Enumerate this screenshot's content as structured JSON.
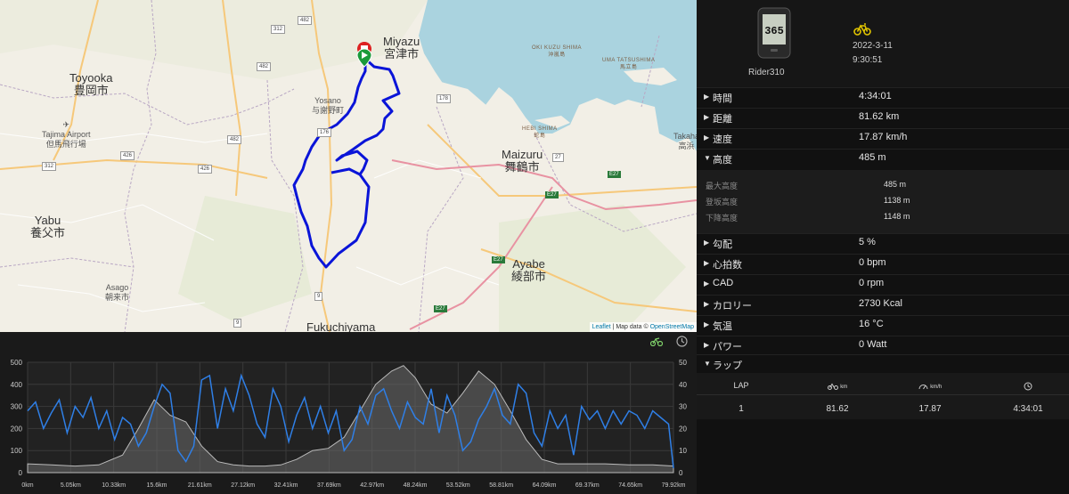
{
  "map": {
    "places": [
      {
        "name": "Toyooka",
        "jp": "豊岡市"
      },
      {
        "name": "Yabu",
        "jp": "養父市"
      },
      {
        "name": "Miyazu",
        "jp": "宮津市"
      },
      {
        "name": "Maizuru",
        "jp": "舞鶴市"
      },
      {
        "name": "Ayabe",
        "jp": "綾部市"
      },
      {
        "name": "Fukuchiyama",
        "jp": ""
      },
      {
        "name": "Yosano",
        "jp": "与謝野町"
      },
      {
        "name": "Asago",
        "jp": "朝来市"
      },
      {
        "name": "Tajima Airport",
        "jp": "但馬飛行場"
      },
      {
        "name": "Takaha",
        "jp": "高浜"
      }
    ],
    "islands": [
      {
        "name": "OKI KUZU SHIMA",
        "jp": "沖嵐島"
      },
      {
        "name": "UMA TATSUSHIMA",
        "jp": "馬立島"
      },
      {
        "name": "HEBI SHIMA",
        "jp": "蛇島"
      }
    ],
    "route_shields": [
      "482",
      "312",
      "426",
      "482",
      "426",
      "312",
      "482",
      "178",
      "176",
      "27",
      "E27",
      "E27",
      "E27",
      "E27",
      "9",
      "9"
    ],
    "attribution": {
      "leaflet": "Leaflet",
      "sep": " | Map data © ",
      "osm": "OpenStreetMap"
    }
  },
  "device": {
    "name": "Rider310",
    "screen_text": "365",
    "date": "2022-3-11",
    "time": "9:30:51"
  },
  "stats": [
    {
      "label": "時間",
      "value": "4:34:01",
      "expanded": false
    },
    {
      "label": "距離",
      "value": "81.62 km",
      "expanded": false
    },
    {
      "label": "速度",
      "value": "17.87 km/h",
      "expanded": false
    },
    {
      "label": "高度",
      "value": "485 m",
      "expanded": true
    },
    {
      "label": "勾配",
      "value": "5 %",
      "expanded": false
    },
    {
      "label": "心拍数",
      "value": "0 bpm",
      "expanded": false
    },
    {
      "label": "CAD",
      "value": "0 rpm",
      "expanded": false
    },
    {
      "label": "カロリー",
      "value": "2730 Kcal",
      "expanded": false
    },
    {
      "label": "気温",
      "value": "16 °C",
      "expanded": false
    },
    {
      "label": "パワー",
      "value": "0 Watt",
      "expanded": false
    },
    {
      "label": "ラップ",
      "value": "",
      "expanded": true
    }
  ],
  "elevation_detail": [
    {
      "label": "最大高度",
      "value": "485 m"
    },
    {
      "label": "登坂高度",
      "value": "1138 m"
    },
    {
      "label": "下降高度",
      "value": "1148 m"
    }
  ],
  "laps": {
    "headers": {
      "lap": "LAP",
      "km": "km",
      "kmh": "km/h"
    },
    "rows": [
      {
        "lap": "1",
        "distance": "81.62",
        "speed": "17.87",
        "time": "4:34:01"
      }
    ]
  },
  "colors": {
    "route": "#0a14d8",
    "speed": "#2f7fe6",
    "altitude_fill": "#6a6a6a",
    "bike": "#e0c400"
  },
  "icons": {
    "bike": "bike-icon",
    "clock": "clock-icon",
    "speedometer": "speedometer-icon",
    "expand": "caret-down-icon",
    "collapsed": "caret-right-icon"
  },
  "chart_data": {
    "type": "line",
    "x_ticks": [
      "0km",
      "5.05km",
      "10.33km",
      "15.6km",
      "21.61km",
      "27.12km",
      "32.41km",
      "37.69km",
      "42.97km",
      "48.24km",
      "53.52km",
      "58.81km",
      "64.09km",
      "69.37km",
      "74.65km",
      "79.92km"
    ],
    "y_left_ticks": [
      "0",
      "100",
      "200",
      "300",
      "400",
      "500"
    ],
    "y_right_ticks": [
      "0",
      "10",
      "20",
      "30",
      "40",
      "50"
    ],
    "ylim_left": [
      0,
      500
    ],
    "ylim_right": [
      0,
      50
    ],
    "grid": true,
    "series": [
      {
        "axis": "left",
        "x": [
          0,
          3,
          6,
          9,
          12,
          14,
          16,
          18,
          20,
          22,
          24,
          26,
          28,
          30,
          32,
          34,
          36,
          38,
          40,
          42,
          44,
          46,
          47.5,
          49,
          51,
          53,
          55,
          57,
          59,
          61,
          63,
          65,
          67,
          70,
          73,
          76,
          79,
          81.62
        ],
        "values": [
          40,
          35,
          30,
          35,
          80,
          200,
          330,
          260,
          230,
          120,
          50,
          35,
          30,
          30,
          35,
          60,
          100,
          110,
          160,
          280,
          400,
          460,
          485,
          430,
          310,
          270,
          360,
          460,
          400,
          280,
          150,
          60,
          40,
          40,
          40,
          35,
          35,
          30
        ]
      },
      {
        "axis": "right",
        "x": [
          0,
          1,
          2,
          3,
          4,
          5,
          6,
          7,
          8,
          9,
          10,
          11,
          12,
          13,
          14,
          15,
          16,
          17,
          18,
          19,
          20,
          21,
          22,
          23,
          24,
          25,
          26,
          27,
          28,
          29,
          30,
          31,
          32,
          33,
          34,
          35,
          36,
          37,
          38,
          39,
          40,
          41,
          42,
          43,
          44,
          45,
          46,
          47,
          48,
          49,
          50,
          51,
          52,
          53,
          54,
          55,
          56,
          57,
          58,
          59,
          60,
          61,
          62,
          63,
          64,
          65,
          66,
          67,
          68,
          69,
          70,
          71,
          72,
          73,
          74,
          75,
          76,
          77,
          78,
          79,
          80,
          81,
          81.62
        ],
        "values": [
          28,
          32,
          20,
          27,
          33,
          18,
          30,
          25,
          34,
          20,
          28,
          15,
          25,
          22,
          12,
          18,
          30,
          40,
          36,
          10,
          5,
          12,
          42,
          44,
          20,
          38,
          28,
          44,
          35,
          22,
          16,
          38,
          30,
          14,
          26,
          34,
          20,
          30,
          18,
          28,
          10,
          15,
          30,
          22,
          35,
          38,
          28,
          20,
          32,
          25,
          22,
          38,
          18,
          35,
          26,
          10,
          14,
          24,
          30,
          38,
          26,
          22,
          40,
          36,
          18,
          12,
          28,
          20,
          26,
          8,
          30,
          24,
          28,
          20,
          28,
          22,
          28,
          26,
          20,
          28,
          25,
          22,
          2
        ]
      }
    ]
  }
}
